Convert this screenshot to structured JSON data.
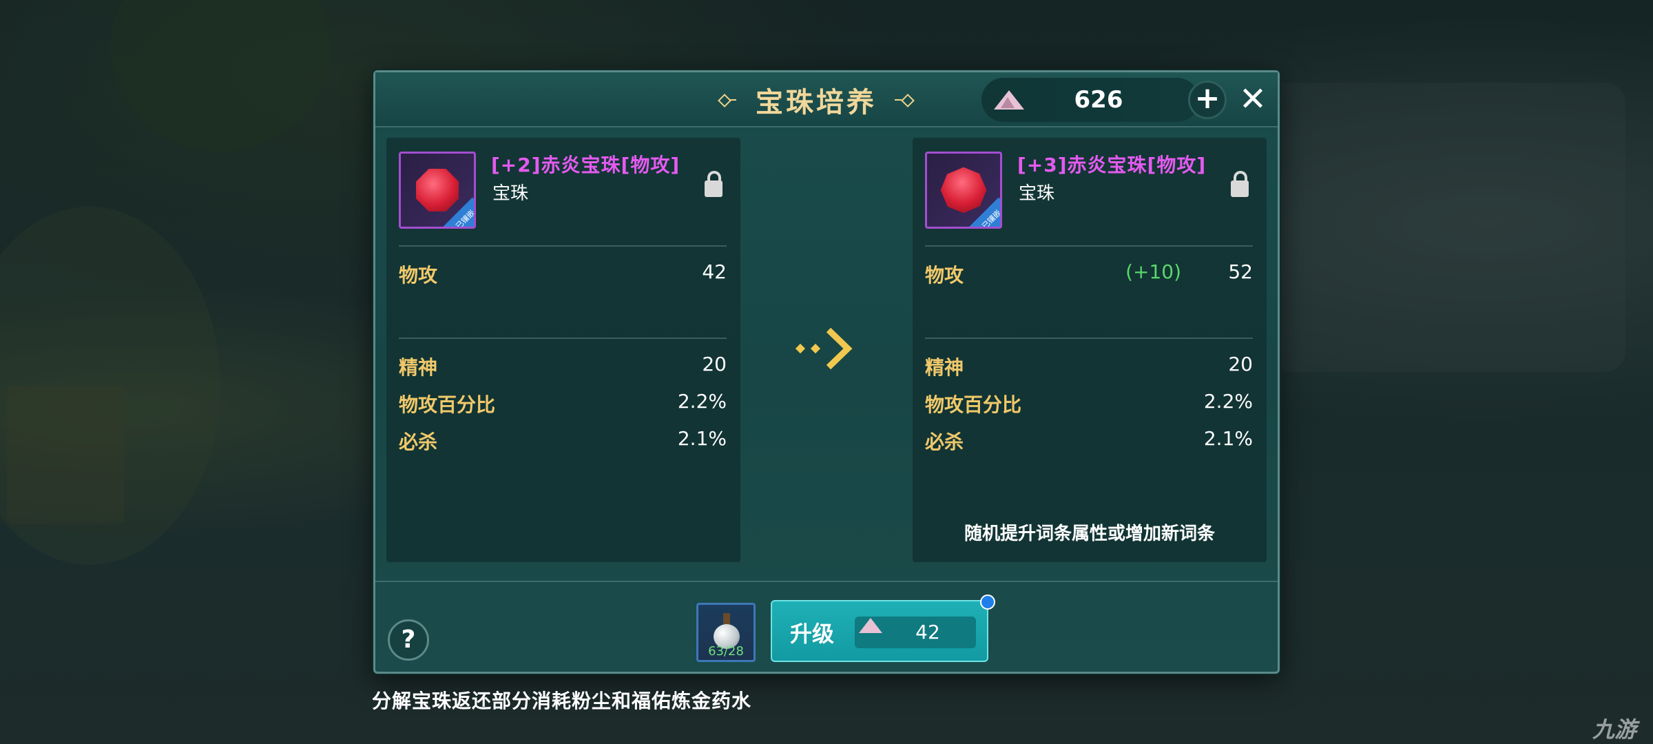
{
  "window": {
    "title": "宝珠培养"
  },
  "currency": {
    "icon": "powder-gem-icon",
    "amount": "626"
  },
  "left_card": {
    "item_name": "[+2]赤炎宝珠[物攻]",
    "item_type": "宝珠",
    "badge": "已镶嵌",
    "stats": [
      {
        "label": "物攻",
        "value": "42"
      },
      {
        "label": "精神",
        "value": "20"
      },
      {
        "label": "物攻百分比",
        "value": "2.2%"
      },
      {
        "label": "必杀",
        "value": "2.1%"
      }
    ]
  },
  "right_card": {
    "item_name": "[+3]赤炎宝珠[物攻]",
    "item_type": "宝珠",
    "badge": "已镶嵌",
    "stats": [
      {
        "label": "物攻",
        "delta": "(+10)",
        "value": "52"
      },
      {
        "label": "精神",
        "value": "20"
      },
      {
        "label": "物攻百分比",
        "value": "2.2%"
      },
      {
        "label": "必杀",
        "value": "2.1%"
      }
    ],
    "note": "随机提升词条属性或增加新词条"
  },
  "footer": {
    "help_label": "?",
    "potion_count": "63/28",
    "upgrade_label": "升级",
    "upgrade_cost": "42"
  },
  "bottom_hint": "分解宝珠返还部分消耗粉尘和福佑炼金药水",
  "watermark": "九游",
  "colors": {
    "accent_gold": "#f1c96a",
    "item_name_purple": "#e45af0",
    "delta_green": "#58d86a",
    "button_teal": "#1fb0b6"
  }
}
